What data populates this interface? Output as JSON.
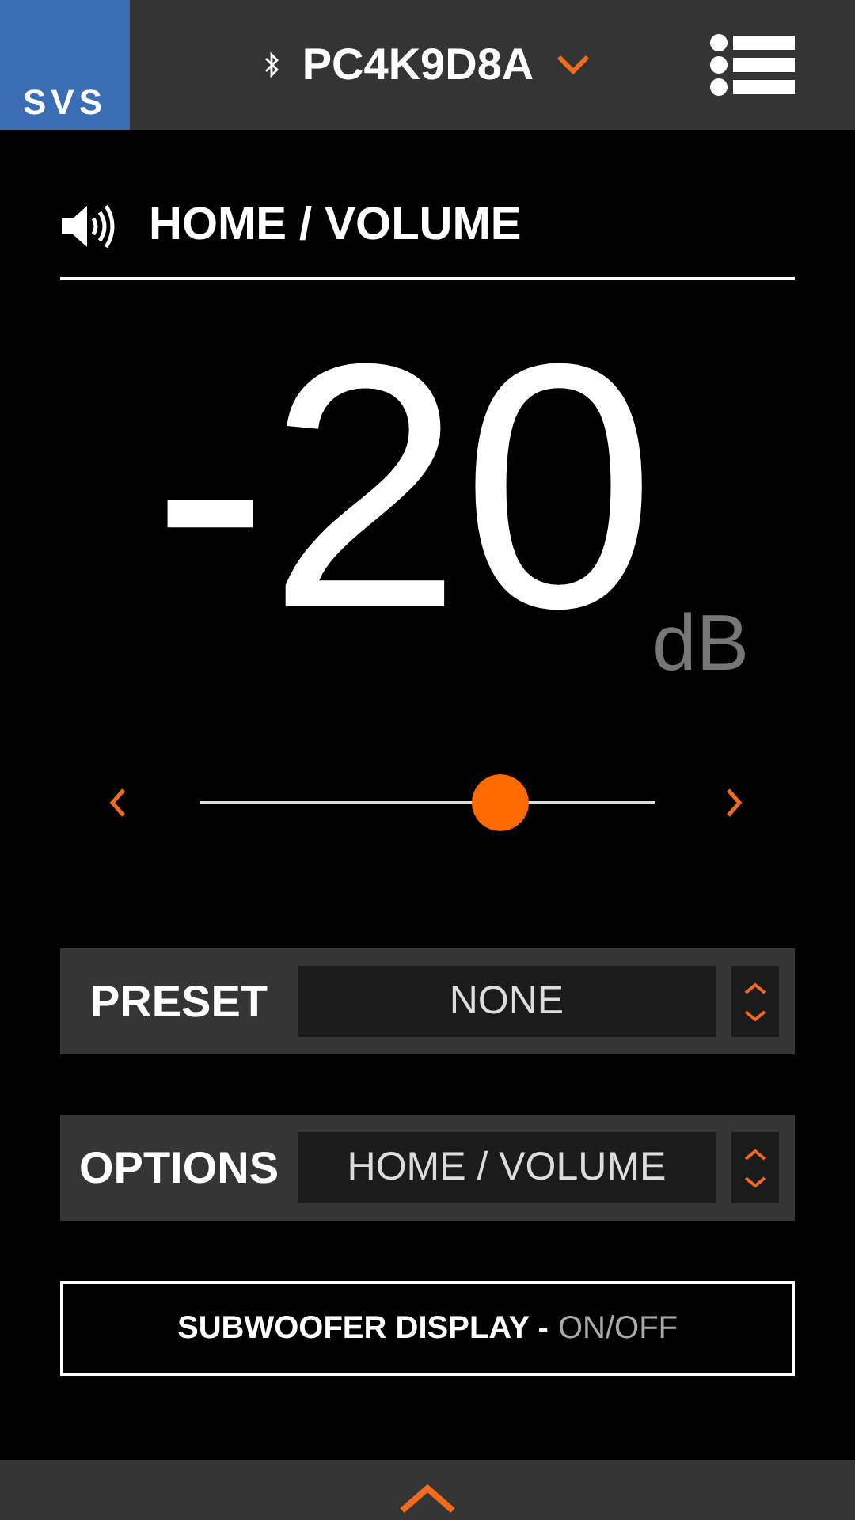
{
  "header": {
    "logo": "SVS",
    "device": "PC4K9D8A"
  },
  "section": {
    "title": "HOME / VOLUME"
  },
  "volume": {
    "value": "-20",
    "unit": "dB",
    "level": 0.66
  },
  "selectors": [
    {
      "label": "PRESET",
      "value": "NONE"
    },
    {
      "label": "OPTIONS",
      "value": "HOME / VOLUME"
    }
  ],
  "toggle": {
    "label": "SUBWOOFER DISPLAY -",
    "value": "ON/OFF"
  }
}
